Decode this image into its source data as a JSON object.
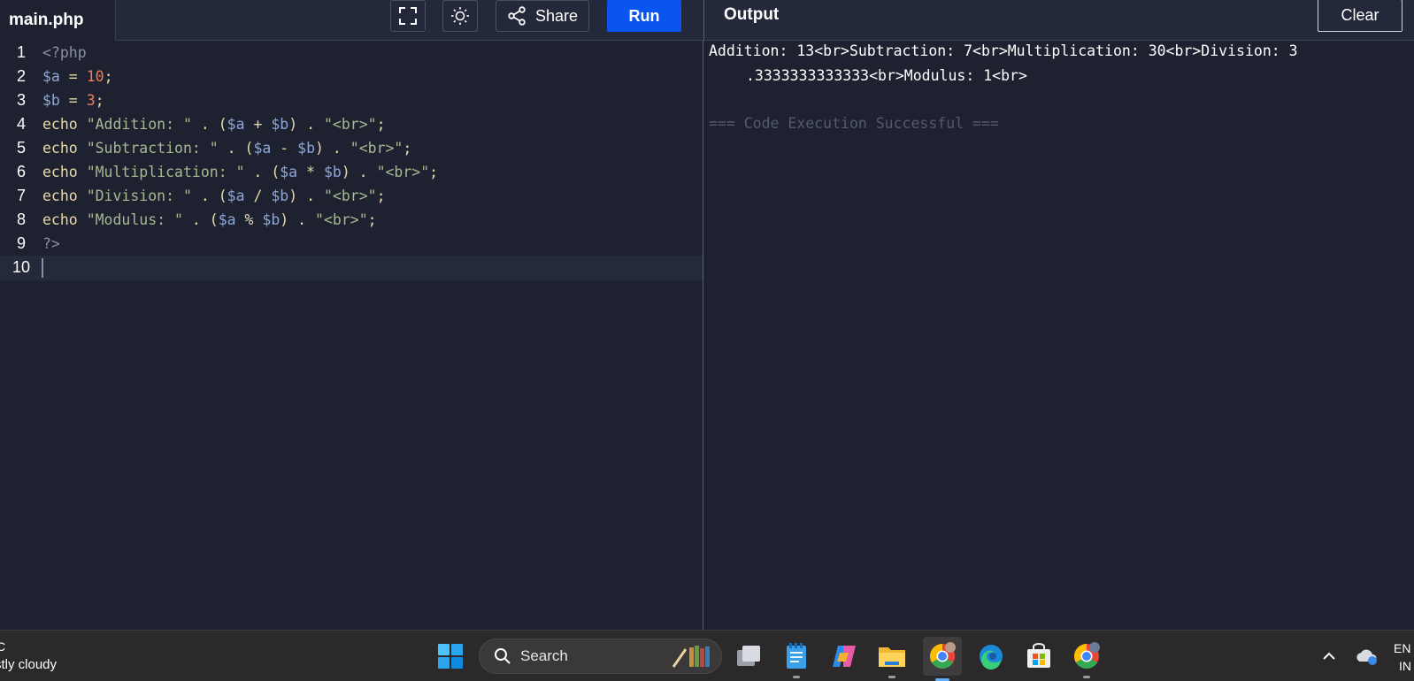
{
  "editor": {
    "filename": "main.php",
    "share_label": "Share",
    "run_label": "Run",
    "line_numbers": [
      "1",
      "2",
      "3",
      "4",
      "5",
      "6",
      "7",
      "8",
      "9",
      "10"
    ]
  },
  "output": {
    "title": "Output",
    "clear_label": "Clear",
    "line1": "Addition: 13<br>Subtraction: 7<br>Multiplication: 30<br>Division: 3",
    "line2": ".3333333333333<br>Modulus: 1<br>",
    "status": "=== Code Execution Successful ==="
  },
  "code": {
    "l1_open": "<?php",
    "l2_var": "$a",
    "l2_eq": " = ",
    "l2_num": "10",
    "l2_end": ";",
    "l3_var": "$b",
    "l3_eq": " = ",
    "l3_num": "3",
    "l3_end": ";",
    "echo": "echo",
    "l4_str": "\"Addition: \"",
    "l5_str": "\"Subtraction: \"",
    "l6_str": "\"Multiplication: \"",
    "l7_str": "\"Division: \"",
    "l8_str": "\"Modulus: \"",
    "dot": " . ",
    "lp": "(",
    "rp": ")",
    "va": "$a",
    "vb": "$b",
    "plus": " + ",
    "minus": " - ",
    "mul": " * ",
    "div": " / ",
    "mod": " % ",
    "br_str": "\"<br>\"",
    "semi": ";",
    "l9_close": "?>"
  },
  "taskbar": {
    "weather_temp": "C",
    "weather_text": "stly cloudy",
    "search_label": "Search",
    "lang_line1": "EN",
    "lang_line2": "IN"
  },
  "icons": [
    "fullscreen-icon",
    "sun-icon",
    "share-icon",
    "search-icon",
    "windows-start-icon",
    "task-view-icon",
    "notepad-icon",
    "copilot-icon",
    "file-explorer-icon",
    "chrome-icon",
    "edge-icon",
    "microsoft-store-icon",
    "chevron-up-icon",
    "onedrive-icon"
  ],
  "colors": {
    "run": "#0a55f0",
    "editor_bg": "#1e2230",
    "keyword": "#e8d9a8",
    "variable": "#8fa6d8",
    "number": "#f07a5a",
    "string": "#a8b890"
  }
}
